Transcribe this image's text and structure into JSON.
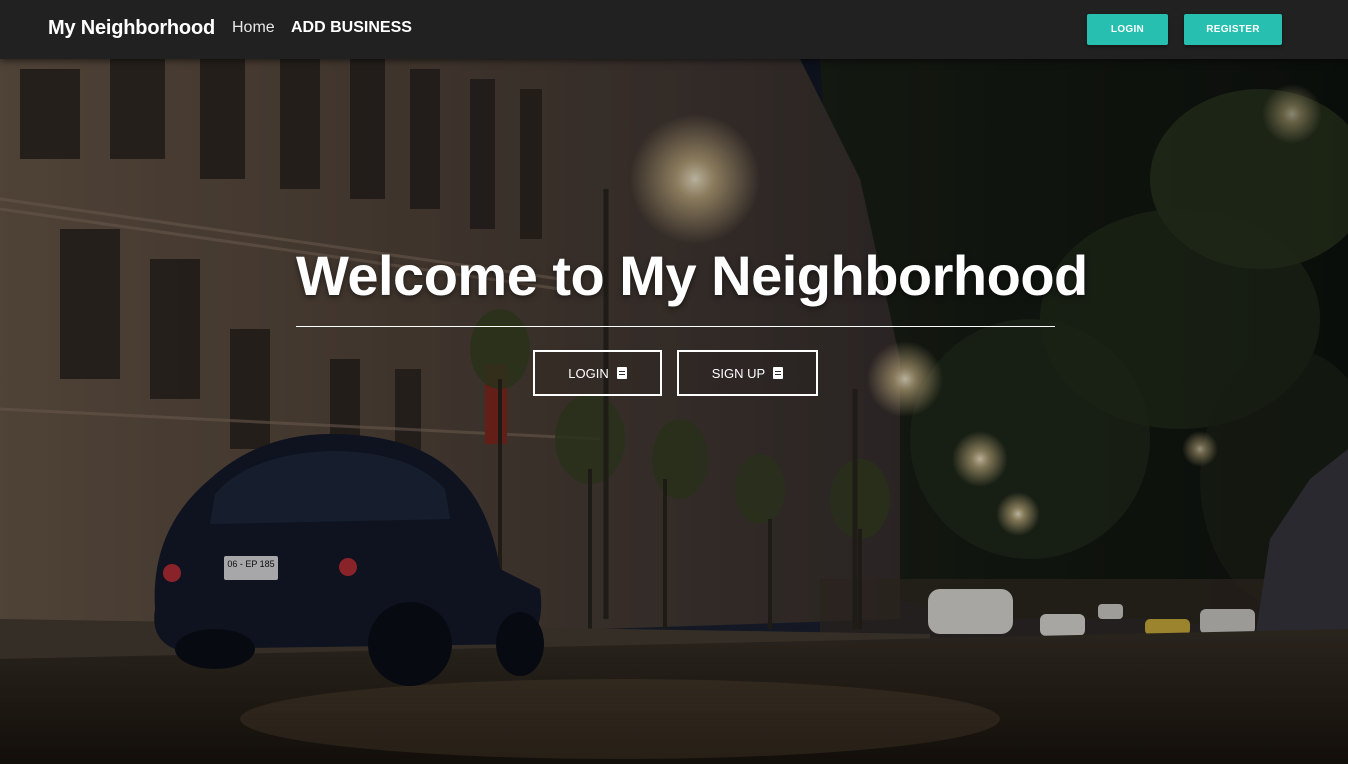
{
  "navbar": {
    "brand": "My Neighborhood",
    "links": {
      "home": "Home",
      "add_business": "ADD BUSINESS"
    },
    "buttons": {
      "login": "LOGIN",
      "register": "REGISTER"
    },
    "accent_color": "#26bfb0",
    "background_color": "#212121"
  },
  "hero": {
    "title": "Welcome to My Neighborhood",
    "buttons": {
      "login": {
        "label": "LOGIN",
        "icon": "document-icon"
      },
      "signup": {
        "label": "SIGN UP",
        "icon": "document-icon"
      }
    },
    "background_image": "night-street-with-vintage-car",
    "car_plate": "06 - EP 185"
  }
}
